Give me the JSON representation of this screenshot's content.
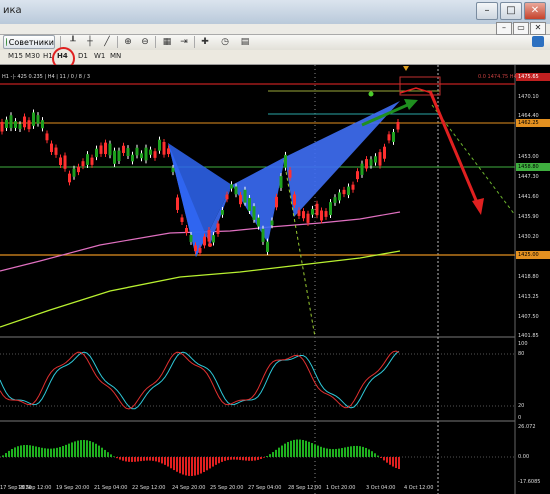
{
  "window": {
    "title": "ика",
    "minimize": "–",
    "maximize": "□",
    "close": "✕"
  },
  "mdi": {
    "minimize": "–",
    "restore": "▭",
    "close": "✕"
  },
  "toolbar": {
    "advisors_label": "Советники"
  },
  "timeframes": {
    "items": [
      "M15",
      "M30",
      "H1",
      "H4",
      "D1",
      "W1",
      "MN"
    ],
    "active": "H4"
  },
  "chart": {
    "info_text": "H1 -|- 425  0.235  | H4 | 11 / 0 / 8 / 3",
    "fib_label": "0.0 1474.75 H4",
    "price_labels": [
      "1475.65",
      "1470.10",
      "1464.40",
      "1462.25",
      "1458.80",
      "1453.00",
      "1447.30",
      "1441.60",
      "1435.90",
      "1430.20",
      "1425.00",
      "1418.80",
      "1413.25",
      "1407.50",
      "1401.85"
    ],
    "osc_labels": [
      "100",
      "80",
      "20",
      "0"
    ],
    "macd_labels": [
      "26.072",
      "0.00",
      "-17.6085"
    ],
    "date_labels": [
      "17 Sep 2020",
      "18 Sep 12:00",
      "19 Sep 20:00",
      "21 Sep 04:00",
      "22 Sep 12:00",
      "24 Sep 20:00",
      "25 Sep 20:00",
      "27 Sep 04:00",
      "28 Sep 12:00",
      "1 Oct 20:00",
      "3 Oct 04:00",
      "4 Oct 12:00"
    ]
  }
}
